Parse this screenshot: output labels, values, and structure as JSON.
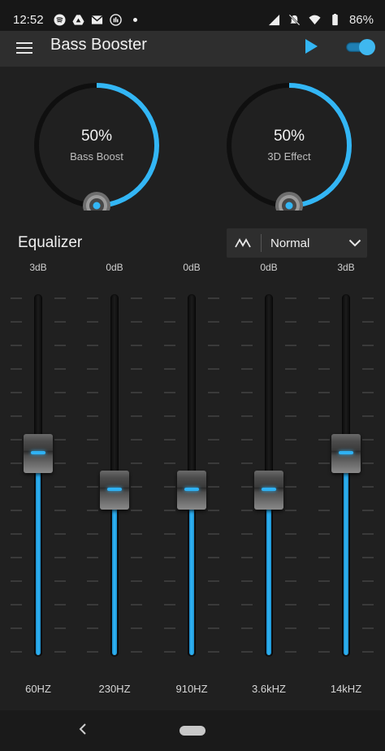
{
  "status_bar": {
    "time": "12:52",
    "battery": "86%",
    "left_icons": [
      "spotify-icon",
      "drive-icon",
      "gmail-icon",
      "app-icon",
      "dot-icon"
    ],
    "right_icons": [
      "signal-icon",
      "mute-icon",
      "wifi-icon",
      "battery-icon"
    ]
  },
  "app_bar": {
    "title": "Bass Booster",
    "menu_icon": "hamburger-menu-icon",
    "play_icon": "play-icon",
    "toggle_on": true
  },
  "knobs": [
    {
      "value": "50%",
      "label": "Bass Boost",
      "level": 0.5
    },
    {
      "value": "50%",
      "label": "3D Effect",
      "level": 0.5
    }
  ],
  "equalizer": {
    "title": "Equalizer",
    "preset": "Normal",
    "preset_icon": "waveform-icon",
    "bands": [
      {
        "db": "3dB",
        "freq": "60HZ",
        "level": 0.56
      },
      {
        "db": "0dB",
        "freq": "230HZ",
        "level": 0.46
      },
      {
        "db": "0dB",
        "freq": "910HZ",
        "level": 0.46
      },
      {
        "db": "0dB",
        "freq": "3.6kHZ",
        "level": 0.46
      },
      {
        "db": "3dB",
        "freq": "14kHZ",
        "level": 0.56
      }
    ]
  },
  "colors": {
    "accent": "#33b6f5",
    "background": "#202020",
    "app_bar": "#2e2e2e"
  }
}
